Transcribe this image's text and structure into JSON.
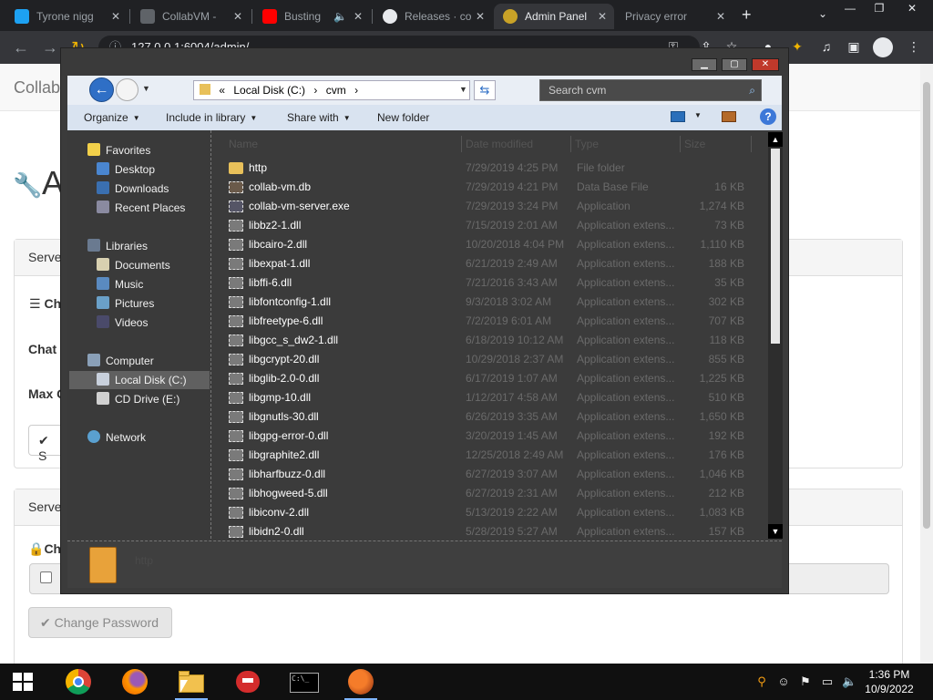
{
  "browser": {
    "tabs": [
      {
        "title": "Tyrone nigg",
        "icon": "twitter-icon",
        "color": "#1da1f2",
        "active": false
      },
      {
        "title": "CollabVM -",
        "icon": "collabvm-icon",
        "color": "#9aa0a6",
        "active": false
      },
      {
        "title": "Busting",
        "icon": "youtube-icon",
        "color": "#ff0000",
        "active": false
      },
      {
        "title": "Releases · co",
        "icon": "github-icon",
        "color": "#e8eaed",
        "active": false
      },
      {
        "title": "Admin Panel",
        "icon": "collabvm-icon",
        "color": "#c9a227",
        "active": true
      },
      {
        "title": "Privacy error",
        "icon": "warning-icon",
        "color": "#9aa0a6",
        "active": false
      }
    ],
    "new_tab": "+",
    "url": "127.0.0.1:6004/admin/"
  },
  "page": {
    "brand": "Collab",
    "heading": "A",
    "panel1_heading": "Serve",
    "label_ch": "Ch",
    "label_chat": "Chat",
    "label_max": "Max C",
    "save_btn": "S",
    "panel2_heading": "Serve",
    "label_pwd": "Ch",
    "change_password_btn": "Change Password"
  },
  "explorer": {
    "breadcrumb": [
      "«",
      "Local Disk (C:)",
      "›",
      "cvm",
      "›"
    ],
    "search_placeholder": "Search cvm",
    "commands": {
      "organize": "Organize",
      "include": "Include in library",
      "share": "Share with",
      "new_folder": "New folder"
    },
    "nav": {
      "favorites": "Favorites",
      "desktop": "Desktop",
      "downloads": "Downloads",
      "recent": "Recent Places",
      "libraries": "Libraries",
      "documents": "Documents",
      "music": "Music",
      "pictures": "Pictures",
      "videos": "Videos",
      "computer": "Computer",
      "local_disk": "Local Disk (C:)",
      "cd_drive": "CD Drive (E:)",
      "network": "Network"
    },
    "columns": {
      "name": "Name",
      "date": "Date modified",
      "type": "Type",
      "size": "Size"
    },
    "files": [
      {
        "name": "http",
        "date": "7/29/2019 4:25 PM",
        "type": "File folder",
        "size": "",
        "kind": "folder"
      },
      {
        "name": "collab-vm.db",
        "date": "7/29/2019 4:21 PM",
        "type": "Data Base File",
        "size": "16 KB",
        "kind": "db"
      },
      {
        "name": "collab-vm-server.exe",
        "date": "7/29/2019 3:24 PM",
        "type": "Application",
        "size": "1,274 KB",
        "kind": "app"
      },
      {
        "name": "libbz2-1.dll",
        "date": "7/15/2019 2:01 AM",
        "type": "Application extens...",
        "size": "73 KB",
        "kind": "dll"
      },
      {
        "name": "libcairo-2.dll",
        "date": "10/20/2018 4:04 PM",
        "type": "Application extens...",
        "size": "1,110 KB",
        "kind": "dll"
      },
      {
        "name": "libexpat-1.dll",
        "date": "6/21/2019 2:49 AM",
        "type": "Application extens...",
        "size": "188 KB",
        "kind": "dll"
      },
      {
        "name": "libffi-6.dll",
        "date": "7/21/2016 3:43 AM",
        "type": "Application extens...",
        "size": "35 KB",
        "kind": "dll"
      },
      {
        "name": "libfontconfig-1.dll",
        "date": "9/3/2018 3:02 AM",
        "type": "Application extens...",
        "size": "302 KB",
        "kind": "dll"
      },
      {
        "name": "libfreetype-6.dll",
        "date": "7/2/2019 6:01 AM",
        "type": "Application extens...",
        "size": "707 KB",
        "kind": "dll"
      },
      {
        "name": "libgcc_s_dw2-1.dll",
        "date": "6/18/2019 10:12 AM",
        "type": "Application extens...",
        "size": "118 KB",
        "kind": "dll"
      },
      {
        "name": "libgcrypt-20.dll",
        "date": "10/29/2018 2:37 AM",
        "type": "Application extens...",
        "size": "855 KB",
        "kind": "dll"
      },
      {
        "name": "libglib-2.0-0.dll",
        "date": "6/17/2019 1:07 AM",
        "type": "Application extens...",
        "size": "1,225 KB",
        "kind": "dll"
      },
      {
        "name": "libgmp-10.dll",
        "date": "1/12/2017 4:58 AM",
        "type": "Application extens...",
        "size": "510 KB",
        "kind": "dll"
      },
      {
        "name": "libgnutls-30.dll",
        "date": "6/26/2019 3:35 AM",
        "type": "Application extens...",
        "size": "1,650 KB",
        "kind": "dll"
      },
      {
        "name": "libgpg-error-0.dll",
        "date": "3/20/2019 1:45 AM",
        "type": "Application extens...",
        "size": "192 KB",
        "kind": "dll"
      },
      {
        "name": "libgraphite2.dll",
        "date": "12/25/2018 2:49 AM",
        "type": "Application extens...",
        "size": "176 KB",
        "kind": "dll"
      },
      {
        "name": "libharfbuzz-0.dll",
        "date": "6/27/2019 3:07 AM",
        "type": "Application extens...",
        "size": "1,046 KB",
        "kind": "dll"
      },
      {
        "name": "libhogweed-5.dll",
        "date": "6/27/2019 2:31 AM",
        "type": "Application extens...",
        "size": "212 KB",
        "kind": "dll"
      },
      {
        "name": "libiconv-2.dll",
        "date": "5/13/2019 2:22 AM",
        "type": "Application extens...",
        "size": "1,083 KB",
        "kind": "dll"
      },
      {
        "name": "libidn2-0.dll",
        "date": "5/28/2019 5:27 AM",
        "type": "Application extens...",
        "size": "157 KB",
        "kind": "dll"
      }
    ],
    "details_name": "http"
  },
  "taskbar": {
    "apps": [
      "chrome-icon",
      "firefox-icon",
      "file-explorer-icon",
      "angry-birds-icon",
      "cmd-icon",
      "collabvm-icon"
    ],
    "time": "1:36 PM",
    "date": "10/9/2022"
  }
}
